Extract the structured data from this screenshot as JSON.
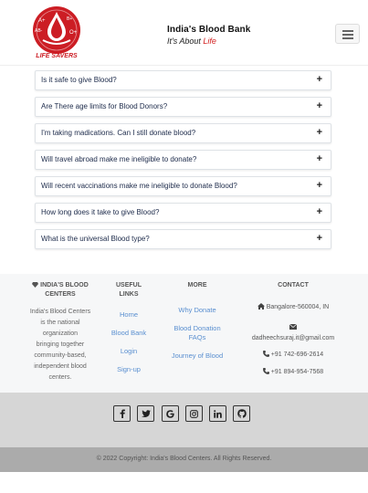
{
  "header": {
    "logo_text": "LIFE SAVERS",
    "logo_blood_types": [
      "A+",
      "B+",
      "AB-",
      "O+"
    ],
    "title": "India's Blood Bank",
    "tagline_prefix": "It's About ",
    "tagline_accent": "Life",
    "menu_icon": "hamburger-icon"
  },
  "faq": [
    {
      "question": "Is it safe to give Blood?"
    },
    {
      "question": "Are There age limits for Blood Donors?"
    },
    {
      "question": "I'm taking madications. Can I still donate blood?"
    },
    {
      "question": "Will travel abroad make me ineligible to donate?"
    },
    {
      "question": "Will recent vaccinations make me ineligible to donate Blood?"
    },
    {
      "question": "How long does it take to give Blood?"
    },
    {
      "question": "What is the universal Blood type?"
    }
  ],
  "faq_toggle": "+",
  "footer": {
    "about": {
      "heading_line1": "INDIA'S BLOOD",
      "heading_line2": "CENTERS",
      "body": [
        "India's Blood Centers",
        "is the national",
        "organization",
        "bringing together",
        "community-based,",
        "independent blood",
        "centers."
      ]
    },
    "useful_links": {
      "heading_line1": "USEFUL",
      "heading_line2": "LINKS",
      "items": [
        "Home",
        "Blood Bank",
        "Login",
        "Sign-up"
      ]
    },
    "more": {
      "heading": "MORE",
      "items": [
        "Why Donate",
        "Blood Donation",
        "FAQs",
        "Journey of Blood"
      ]
    },
    "contact": {
      "heading": "CONTACT",
      "address": "Bangalore-560004, IN",
      "email": "dadheechsuraj.it@gmail.com",
      "phone1": "+91 742-696-2614",
      "phone2": "+91 894-954-7568"
    }
  },
  "social_icons": [
    "facebook-icon",
    "twitter-icon",
    "google-icon",
    "instagram-icon",
    "linkedin-icon",
    "github-icon"
  ],
  "copyright": "© 2022 Copyright: India's Blood Centers. All Rights Reserved.",
  "colors": {
    "brand_red": "#d21f1f",
    "link_blue": "#5a8fd0",
    "footer_bg": "#f6f7f8",
    "social_band": "#d6d6d6",
    "copyright_band": "#ababab"
  }
}
